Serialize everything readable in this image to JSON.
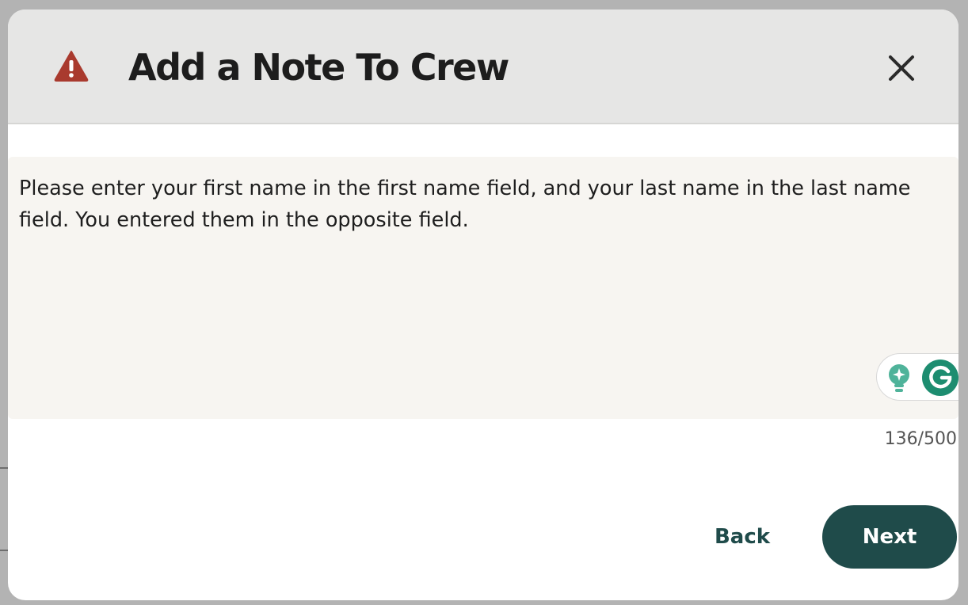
{
  "modal": {
    "title": "Add a Note To Crew",
    "warning_icon": "warning-triangle-icon",
    "close_icon": "close-icon"
  },
  "note": {
    "value": "Please enter your first name in the first name field, and your last name in the last name field. You entered them in the opposite field.",
    "char_count": "136/500"
  },
  "grammarly": {
    "bulb_icon": "lightbulb-icon",
    "logo_icon": "grammarly-g-icon"
  },
  "actions": {
    "back_label": "Back",
    "next_label": "Next"
  },
  "colors": {
    "accent": "#1f4b4a",
    "warning": "#a93a2e",
    "header_bg": "#e6e6e5",
    "textarea_bg": "#f7f5f1"
  }
}
